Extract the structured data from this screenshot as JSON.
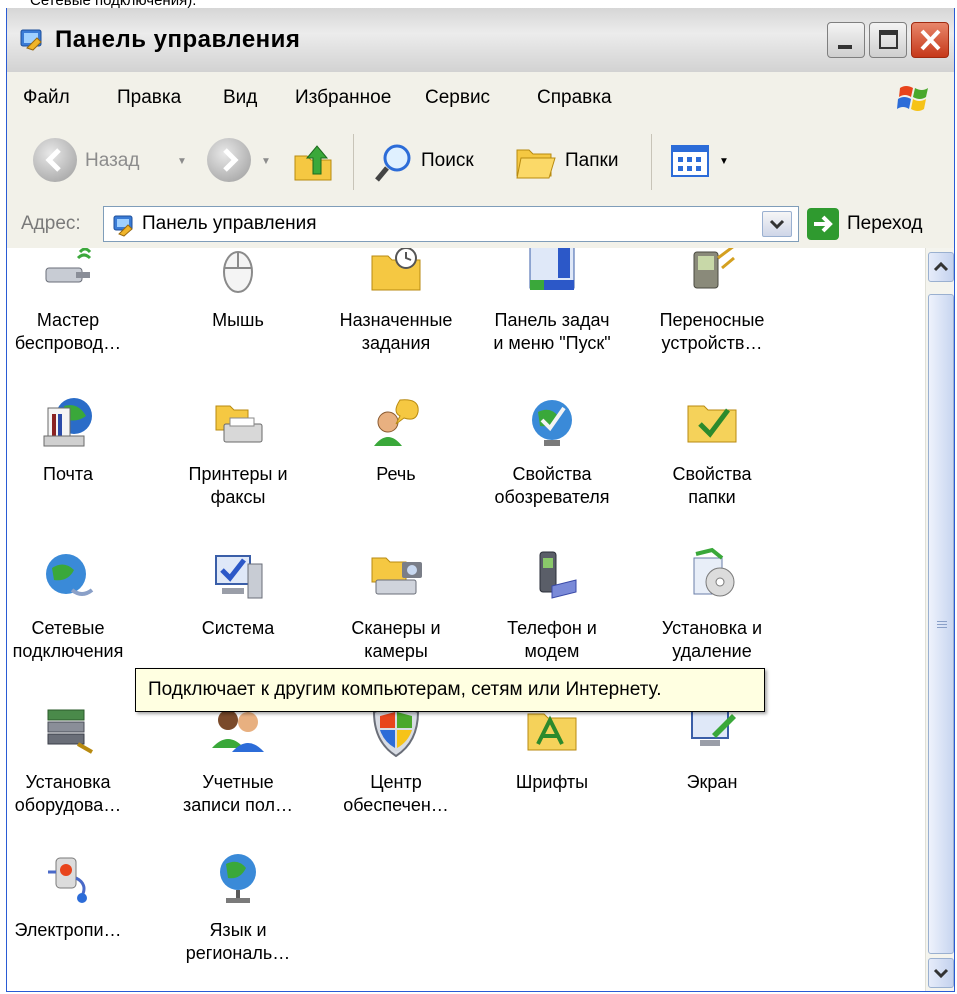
{
  "page": {
    "caption": "Сетевые подключения)."
  },
  "window": {
    "title": "Панель управления"
  },
  "menu": {
    "items": [
      "Файл",
      "Правка",
      "Вид",
      "Избранное",
      "Сервис",
      "Справка"
    ]
  },
  "toolbar": {
    "back_label": "Назад",
    "search_label": "Поиск",
    "folders_label": "Папки"
  },
  "address": {
    "label": "Адрес:",
    "value": "Панель управления",
    "go_label": "Переход"
  },
  "items": [
    {
      "line1": "Мастер",
      "line2": "беспровод…",
      "icon": "wireless-icon"
    },
    {
      "line1": "Мышь",
      "line2": "",
      "icon": "mouse-icon"
    },
    {
      "line1": "Назначенные",
      "line2": "задания",
      "icon": "scheduled-tasks-icon"
    },
    {
      "line1": "Панель задач",
      "line2": "и меню \"Пуск\"",
      "icon": "taskbar-icon"
    },
    {
      "line1": "Переносные",
      "line2": "устройств…",
      "icon": "portable-devices-icon"
    },
    {
      "line1": "Почта",
      "line2": "",
      "icon": "mail-icon"
    },
    {
      "line1": "Принтеры и",
      "line2": "факсы",
      "icon": "printer-icon"
    },
    {
      "line1": "Речь",
      "line2": "",
      "icon": "speech-icon"
    },
    {
      "line1": "Свойства",
      "line2": "обозревателя",
      "icon": "internet-options-icon"
    },
    {
      "line1": "Свойства",
      "line2": "папки",
      "icon": "folder-options-icon"
    },
    {
      "line1": "Сетевые",
      "line2": "подключения",
      "icon": "network-icon"
    },
    {
      "line1": "Система",
      "line2": "",
      "icon": "system-icon"
    },
    {
      "line1": "Сканеры и",
      "line2": "камеры",
      "icon": "scanner-icon"
    },
    {
      "line1": "Телефон и",
      "line2": "модем",
      "icon": "phone-modem-icon"
    },
    {
      "line1": "Установка и",
      "line2": "удаление",
      "icon": "add-remove-icon"
    },
    {
      "line1": "Установка",
      "line2": "оборудова…",
      "icon": "hardware-icon"
    },
    {
      "line1": "Учетные",
      "line2": "записи пол…",
      "icon": "user-accounts-icon"
    },
    {
      "line1": "Центр",
      "line2": "обеспечен…",
      "icon": "security-center-icon"
    },
    {
      "line1": "Шрифты",
      "line2": "",
      "icon": "fonts-icon"
    },
    {
      "line1": "Экран",
      "line2": "",
      "icon": "display-icon"
    },
    {
      "line1": "Электропи…",
      "line2": "",
      "icon": "power-icon"
    },
    {
      "line1": "Язык и",
      "line2": "региональ…",
      "icon": "language-icon"
    }
  ],
  "tooltip": {
    "text": "Подключает к другим компьютерам, сетям или Интернету."
  }
}
